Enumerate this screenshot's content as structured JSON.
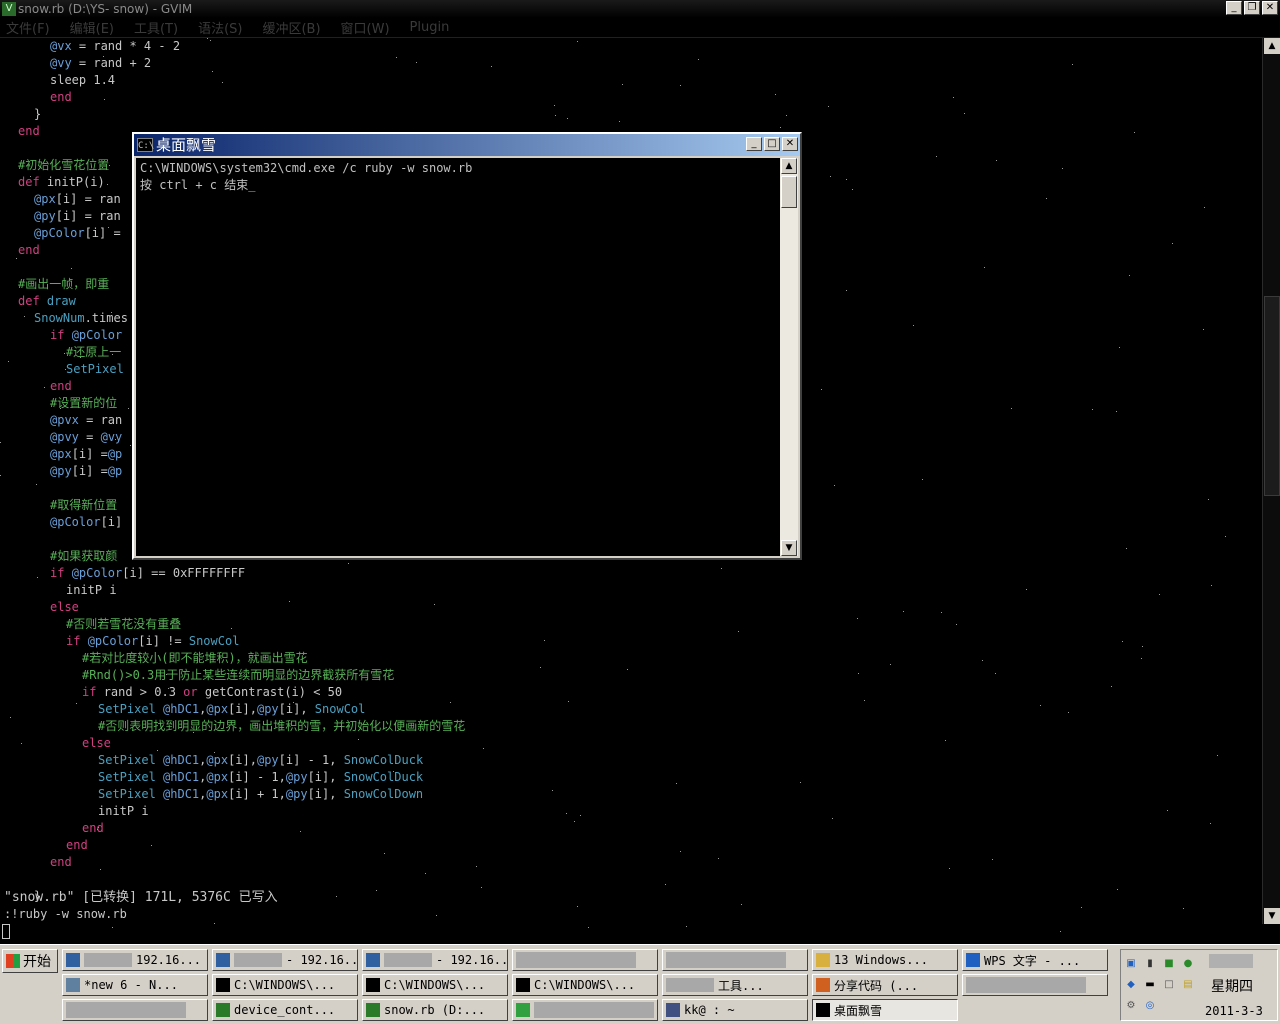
{
  "gvim": {
    "title": "snow.rb (D:\\YS-         snow) - GVIM",
    "menu": [
      "文件(F)",
      "编辑(E)",
      "工具(T)",
      "语法(S)",
      "缓冲区(B)",
      "窗口(W)",
      "Plugin"
    ],
    "code_lines": [
      {
        "indent": 6,
        "parts": [
          {
            "t": "@vx",
            "c": "ivar"
          },
          {
            "t": " = rand * 4 - 2",
            "c": "plain"
          }
        ]
      },
      {
        "indent": 6,
        "parts": [
          {
            "t": "@vy",
            "c": "ivar"
          },
          {
            "t": " = rand + 2",
            "c": "plain"
          }
        ]
      },
      {
        "indent": 6,
        "parts": [
          {
            "t": "sleep 1.4",
            "c": "plain"
          }
        ]
      },
      {
        "indent": 6,
        "parts": [
          {
            "t": "end",
            "c": "kw"
          }
        ]
      },
      {
        "indent": 4,
        "parts": [
          {
            "t": "}",
            "c": "plain"
          }
        ]
      },
      {
        "indent": 2,
        "parts": [
          {
            "t": "end",
            "c": "kw"
          }
        ]
      },
      {
        "indent": 0,
        "parts": []
      },
      {
        "indent": 2,
        "parts": [
          {
            "t": "#初始化雪花位置",
            "c": "cmt"
          }
        ]
      },
      {
        "indent": 2,
        "parts": [
          {
            "t": "def ",
            "c": "kw"
          },
          {
            "t": "initP(i)",
            "c": "plain"
          }
        ]
      },
      {
        "indent": 4,
        "parts": [
          {
            "t": "@px",
            "c": "ivar"
          },
          {
            "t": "[i] = ran",
            "c": "plain"
          }
        ]
      },
      {
        "indent": 4,
        "parts": [
          {
            "t": "@py",
            "c": "ivar"
          },
          {
            "t": "[i] = ran",
            "c": "plain"
          }
        ]
      },
      {
        "indent": 4,
        "parts": [
          {
            "t": "@pColor",
            "c": "ivar"
          },
          {
            "t": "[i] =",
            "c": "plain"
          }
        ]
      },
      {
        "indent": 2,
        "parts": [
          {
            "t": "end",
            "c": "kw"
          }
        ]
      },
      {
        "indent": 0,
        "parts": []
      },
      {
        "indent": 2,
        "parts": [
          {
            "t": "#画出一帧，即重",
            "c": "cmt"
          }
        ]
      },
      {
        "indent": 2,
        "parts": [
          {
            "t": "def ",
            "c": "kw"
          },
          {
            "t": "draw",
            "c": "const"
          }
        ]
      },
      {
        "indent": 4,
        "parts": [
          {
            "t": "SnowNum",
            "c": "const"
          },
          {
            "t": ".times",
            "c": "plain"
          }
        ]
      },
      {
        "indent": 6,
        "parts": [
          {
            "t": "if ",
            "c": "kw"
          },
          {
            "t": "@pColor",
            "c": "ivar"
          }
        ]
      },
      {
        "indent": 8,
        "parts": [
          {
            "t": "#还原上一",
            "c": "cmt"
          }
        ]
      },
      {
        "indent": 8,
        "parts": [
          {
            "t": "SetPixel",
            "c": "const"
          }
        ]
      },
      {
        "indent": 6,
        "parts": [
          {
            "t": "end",
            "c": "kw"
          }
        ]
      },
      {
        "indent": 6,
        "parts": [
          {
            "t": "#设置新的位",
            "c": "cmt"
          }
        ]
      },
      {
        "indent": 6,
        "parts": [
          {
            "t": "@pvx",
            "c": "ivar"
          },
          {
            "t": " = ran",
            "c": "plain"
          }
        ]
      },
      {
        "indent": 6,
        "parts": [
          {
            "t": "@pvy",
            "c": "ivar"
          },
          {
            "t": " = ",
            "c": "plain"
          },
          {
            "t": "@vy",
            "c": "ivar"
          }
        ]
      },
      {
        "indent": 6,
        "parts": [
          {
            "t": "@px",
            "c": "ivar"
          },
          {
            "t": "[i] =",
            "c": "plain"
          },
          {
            "t": "@p",
            "c": "ivar"
          }
        ]
      },
      {
        "indent": 6,
        "parts": [
          {
            "t": "@py",
            "c": "ivar"
          },
          {
            "t": "[i] =",
            "c": "plain"
          },
          {
            "t": "@p",
            "c": "ivar"
          }
        ]
      },
      {
        "indent": 0,
        "parts": []
      },
      {
        "indent": 6,
        "parts": [
          {
            "t": "#取得新位置",
            "c": "cmt"
          }
        ]
      },
      {
        "indent": 6,
        "parts": [
          {
            "t": "@pColor",
            "c": "ivar"
          },
          {
            "t": "[i]",
            "c": "plain"
          }
        ]
      },
      {
        "indent": 0,
        "parts": []
      },
      {
        "indent": 6,
        "parts": [
          {
            "t": "#如果获取颜",
            "c": "cmt"
          }
        ]
      },
      {
        "indent": 6,
        "parts": [
          {
            "t": "if ",
            "c": "kw"
          },
          {
            "t": "@pColor",
            "c": "ivar"
          },
          {
            "t": "[i] == 0xFFFFFFFF",
            "c": "plain"
          }
        ]
      },
      {
        "indent": 8,
        "parts": [
          {
            "t": "initP i",
            "c": "plain"
          }
        ]
      },
      {
        "indent": 6,
        "parts": [
          {
            "t": "else",
            "c": "kw"
          }
        ]
      },
      {
        "indent": 8,
        "parts": [
          {
            "t": "#否则若雪花没有重叠",
            "c": "cmt"
          }
        ]
      },
      {
        "indent": 8,
        "parts": [
          {
            "t": "if ",
            "c": "kw"
          },
          {
            "t": "@pColor",
            "c": "ivar"
          },
          {
            "t": "[i] != ",
            "c": "plain"
          },
          {
            "t": "SnowCol",
            "c": "const"
          }
        ]
      },
      {
        "indent": 10,
        "parts": [
          {
            "t": "#若对比度较小(即不能堆积)，就画出雪花",
            "c": "cmt"
          }
        ]
      },
      {
        "indent": 10,
        "parts": [
          {
            "t": "#Rnd()>0.3用于防止某些连续而明显的边界截获所有雪花",
            "c": "cmt"
          }
        ]
      },
      {
        "indent": 10,
        "parts": [
          {
            "t": "if ",
            "c": "kw"
          },
          {
            "t": "rand > 0.3 ",
            "c": "plain"
          },
          {
            "t": "or ",
            "c": "kw"
          },
          {
            "t": "getContrast(i) < 50",
            "c": "plain"
          }
        ]
      },
      {
        "indent": 12,
        "parts": [
          {
            "t": "SetPixel ",
            "c": "const"
          },
          {
            "t": "@hDC1",
            "c": "ivar"
          },
          {
            "t": ",",
            "c": "plain"
          },
          {
            "t": "@px",
            "c": "ivar"
          },
          {
            "t": "[i],",
            "c": "plain"
          },
          {
            "t": "@py",
            "c": "ivar"
          },
          {
            "t": "[i], ",
            "c": "plain"
          },
          {
            "t": "SnowCol",
            "c": "const"
          }
        ]
      },
      {
        "indent": 12,
        "parts": [
          {
            "t": "#否则表明找到明显的边界，画出堆积的雪，并初始化以便画新的雪花",
            "c": "cmt"
          }
        ]
      },
      {
        "indent": 10,
        "parts": [
          {
            "t": "else",
            "c": "kw"
          }
        ]
      },
      {
        "indent": 12,
        "parts": [
          {
            "t": "SetPixel ",
            "c": "const"
          },
          {
            "t": "@hDC1",
            "c": "ivar"
          },
          {
            "t": ",",
            "c": "plain"
          },
          {
            "t": "@px",
            "c": "ivar"
          },
          {
            "t": "[i],",
            "c": "plain"
          },
          {
            "t": "@py",
            "c": "ivar"
          },
          {
            "t": "[i] - 1, ",
            "c": "plain"
          },
          {
            "t": "SnowColDuck",
            "c": "const"
          }
        ]
      },
      {
        "indent": 12,
        "parts": [
          {
            "t": "SetPixel ",
            "c": "const"
          },
          {
            "t": "@hDC1",
            "c": "ivar"
          },
          {
            "t": ",",
            "c": "plain"
          },
          {
            "t": "@px",
            "c": "ivar"
          },
          {
            "t": "[i] - 1,",
            "c": "plain"
          },
          {
            "t": "@py",
            "c": "ivar"
          },
          {
            "t": "[i], ",
            "c": "plain"
          },
          {
            "t": "SnowColDuck",
            "c": "const"
          }
        ]
      },
      {
        "indent": 12,
        "parts": [
          {
            "t": "SetPixel ",
            "c": "const"
          },
          {
            "t": "@hDC1",
            "c": "ivar"
          },
          {
            "t": ",",
            "c": "plain"
          },
          {
            "t": "@px",
            "c": "ivar"
          },
          {
            "t": "[i] + 1,",
            "c": "plain"
          },
          {
            "t": "@py",
            "c": "ivar"
          },
          {
            "t": "[i], ",
            "c": "plain"
          },
          {
            "t": "SnowColDown",
            "c": "const"
          }
        ]
      },
      {
        "indent": 12,
        "parts": [
          {
            "t": "initP i",
            "c": "plain"
          }
        ]
      },
      {
        "indent": 10,
        "parts": [
          {
            "t": "end",
            "c": "kw"
          }
        ]
      },
      {
        "indent": 8,
        "parts": [
          {
            "t": "end",
            "c": "kw"
          }
        ]
      },
      {
        "indent": 6,
        "parts": [
          {
            "t": "end",
            "c": "kw"
          }
        ]
      },
      {
        "indent": 0,
        "parts": []
      },
      {
        "indent": 4,
        "parts": [
          {
            "t": "}",
            "c": "plain"
          }
        ]
      }
    ],
    "status_message": "\"snow.rb\" [已转换] 171L, 5376C 已写入",
    "command_line": ":!ruby -w snow.rb"
  },
  "cmd_window": {
    "title": "桌面飘雪",
    "icon": "C:\\",
    "lines": [
      "C:\\WINDOWS\\system32\\cmd.exe /c ruby -w snow.rb",
      "按 ctrl + c 结束_"
    ]
  },
  "taskbar": {
    "start_label": "开始",
    "row1": [
      {
        "label": "192.16...",
        "icon": "computer-icon",
        "redact": true
      },
      {
        "label": "- 192.16...",
        "icon": "computer-icon",
        "redact": true
      },
      {
        "label": "- 192.16...",
        "icon": "computer-icon",
        "redact": true
      },
      {
        "label": "",
        "icon": "",
        "redact_wide": true
      },
      {
        "label": "",
        "icon": "",
        "redact_wide": true
      },
      {
        "label": "13 Windows...",
        "icon": "folder-icon",
        "redact": false
      },
      {
        "label": "WPS 文字 - ...",
        "icon": "wps-icon",
        "redact": false
      }
    ],
    "row2": [
      {
        "label": "*new  6 - N...",
        "icon": "notepad-icon",
        "redact": false
      },
      {
        "label": "C:\\WINDOWS\\...",
        "icon": "cmd-icon",
        "redact": false
      },
      {
        "label": "C:\\WINDOWS\\...",
        "icon": "cmd-icon",
        "redact": false
      },
      {
        "label": "C:\\WINDOWS\\...",
        "icon": "cmd-icon",
        "redact": false
      },
      {
        "label": "工具...",
        "icon": "",
        "redact": true
      },
      {
        "label": "分享代码 (...",
        "icon": "firefox-icon",
        "redact": false
      },
      {
        "label": "",
        "icon": "",
        "redact_wide": true
      }
    ],
    "row3": [
      {
        "label": "",
        "icon": "",
        "redact_wide": true
      },
      {
        "label": "device_cont...",
        "icon": "vim-icon",
        "redact": false
      },
      {
        "label": "snow.rb (D:...",
        "icon": "vim-icon",
        "redact": false
      },
      {
        "label": "",
        "icon": "chrome-icon",
        "redact_wide": true
      },
      {
        "label": "kk@     : ~",
        "icon": "putty-icon",
        "redact": false
      },
      {
        "label": "桌面飘雪",
        "icon": "cmd-icon",
        "redact": false,
        "active": true
      }
    ],
    "clock": {
      "weekday": "星期四",
      "date": "2011-3-3"
    }
  }
}
